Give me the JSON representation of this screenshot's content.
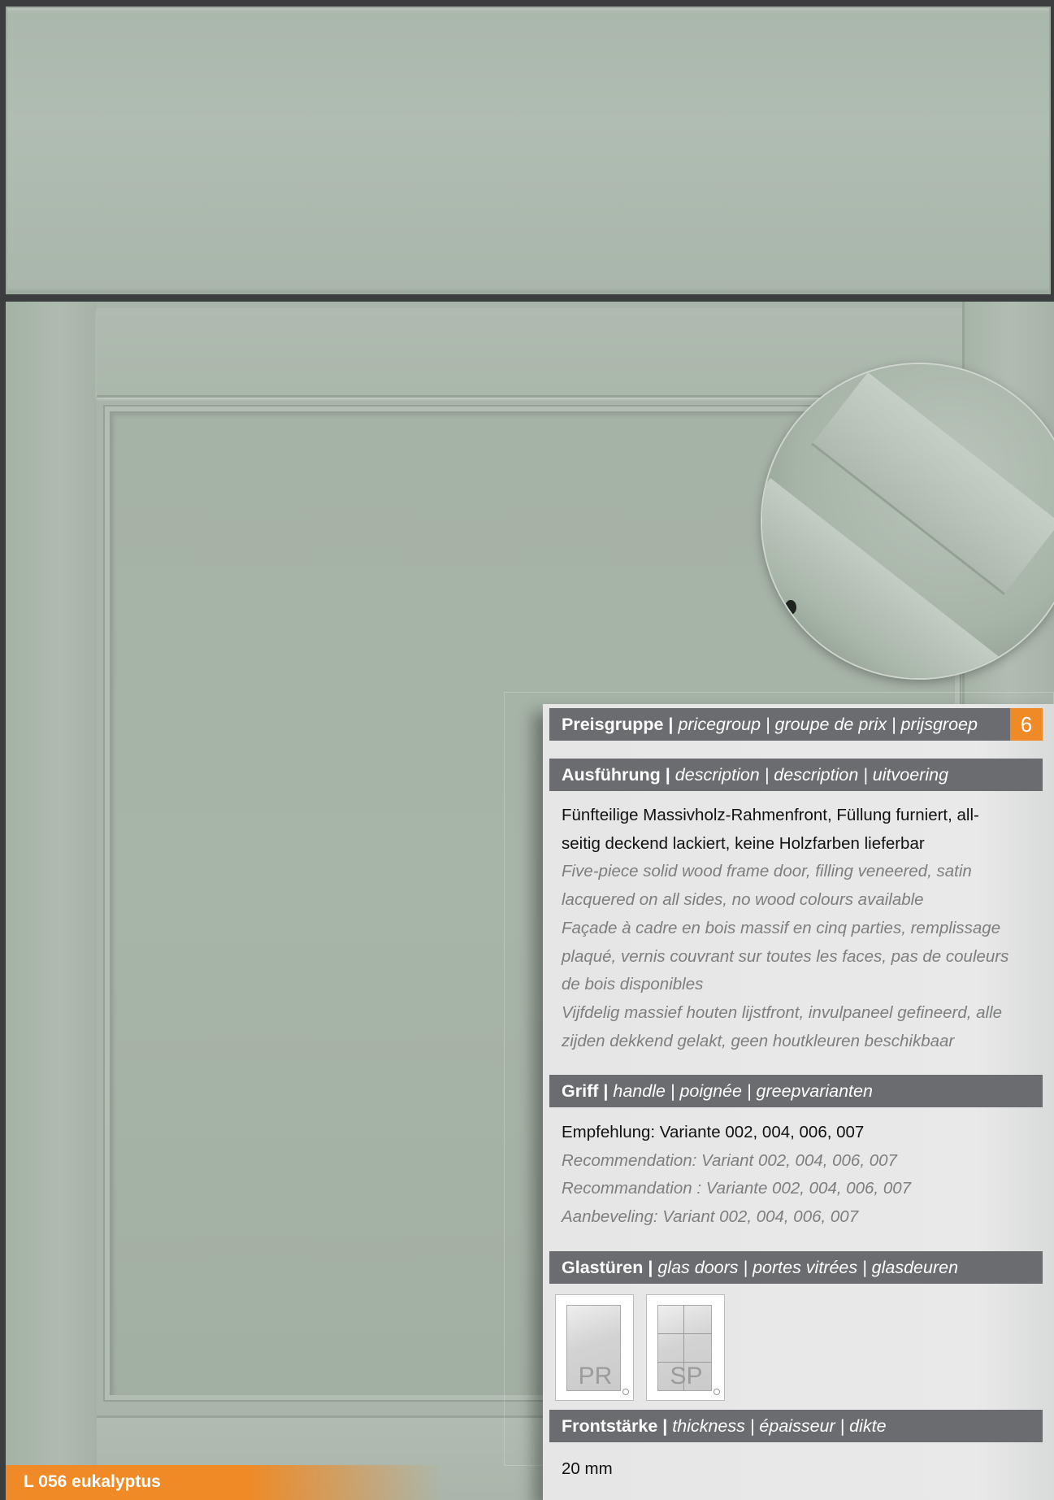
{
  "product_name": "L 056 eukalyptus",
  "price_group": {
    "label_bold": "Preisgruppe |",
    "label_rest": "pricegroup | groupe de prix | prijsgroep",
    "value": "6"
  },
  "description": {
    "label_bold": "Ausführung |",
    "label_rest": "description | description | uitvoering",
    "de_lines": [
      "Fünfteilige Massivholz-Rahmenfront, Füllung furniert, all-",
      "seitig deckend lackiert, keine Holzfarben lieferbar"
    ],
    "en_lines": [
      "Five-piece solid wood frame door, filling veneered, satin",
      "lacquered on all sides, no wood colours available"
    ],
    "fr_lines": [
      "Façade à cadre en bois massif en cinq parties, remplissage",
      "plaqué, vernis couvrant sur toutes les faces, pas de couleurs",
      "de bois disponibles"
    ],
    "nl_lines": [
      "Vijfdelig massief houten lijstfront, invulpaneel gefineerd, alle",
      "zijden dekkend gelakt, geen houtkleuren beschikbaar"
    ]
  },
  "handle": {
    "label_bold": "Griff |",
    "label_rest": "handle | poignée | greepvarianten",
    "de": "Empfehlung: Variante 002, 004, 006, 007",
    "en": "Recommendation: Variant 002, 004, 006, 007",
    "fr": "Recommandation : Variante 002, 004, 006, 007",
    "nl": "Aanbeveling: Variant 002, 004, 006, 007"
  },
  "glass_doors": {
    "label_bold": "Glastüren |",
    "label_rest": "glas doors | portes vitrées | glasdeuren",
    "options": [
      {
        "code": "PR",
        "icon": "glass-door-plain-icon"
      },
      {
        "code": "SP",
        "icon": "glass-door-mullion-icon"
      }
    ]
  },
  "thickness": {
    "label_bold": "Frontstärke |",
    "label_rest": "thickness | épaisseur | dikte",
    "value": "20 mm"
  },
  "colors": {
    "front": "#a9b5aa",
    "accent": "#ef8a26",
    "header_bg": "#6b6c6f"
  }
}
